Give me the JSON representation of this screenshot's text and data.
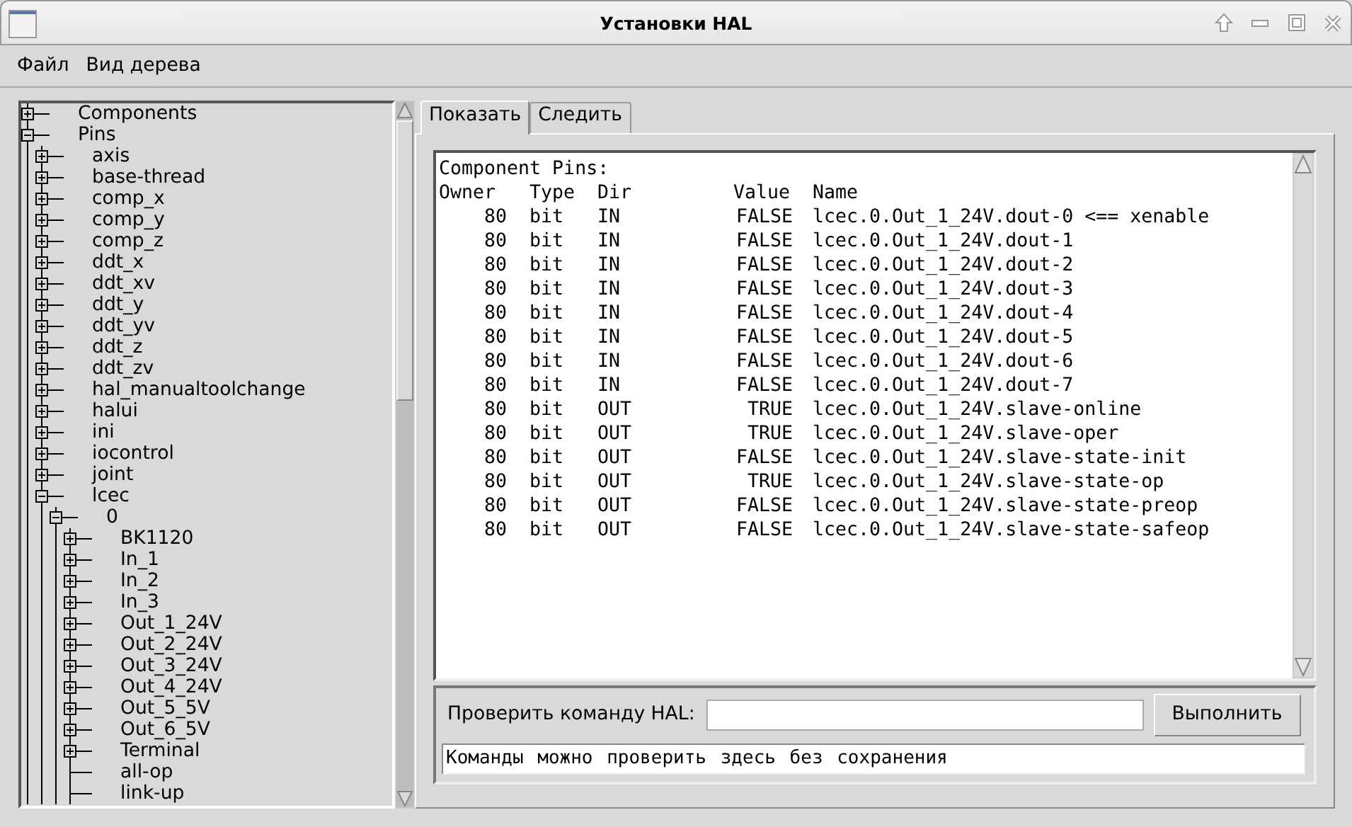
{
  "window": {
    "title": "Установки HAL"
  },
  "menu": [
    "Файл",
    "Вид дерева"
  ],
  "tree": [
    {
      "label": "Components",
      "kind": "branch",
      "expanded": false
    },
    {
      "label": "Pins",
      "kind": "branch",
      "expanded": true,
      "children": [
        {
          "label": "axis",
          "kind": "branch",
          "expanded": false
        },
        {
          "label": "base-thread",
          "kind": "branch",
          "expanded": false
        },
        {
          "label": "comp_x",
          "kind": "branch",
          "expanded": false
        },
        {
          "label": "comp_y",
          "kind": "branch",
          "expanded": false
        },
        {
          "label": "comp_z",
          "kind": "branch",
          "expanded": false
        },
        {
          "label": "ddt_x",
          "kind": "branch",
          "expanded": false
        },
        {
          "label": "ddt_xv",
          "kind": "branch",
          "expanded": false
        },
        {
          "label": "ddt_y",
          "kind": "branch",
          "expanded": false
        },
        {
          "label": "ddt_yv",
          "kind": "branch",
          "expanded": false
        },
        {
          "label": "ddt_z",
          "kind": "branch",
          "expanded": false
        },
        {
          "label": "ddt_zv",
          "kind": "branch",
          "expanded": false
        },
        {
          "label": "hal_manualtoolchange",
          "kind": "branch",
          "expanded": false
        },
        {
          "label": "halui",
          "kind": "branch",
          "expanded": false
        },
        {
          "label": "ini",
          "kind": "branch",
          "expanded": false
        },
        {
          "label": "iocontrol",
          "kind": "branch",
          "expanded": false
        },
        {
          "label": "joint",
          "kind": "branch",
          "expanded": false
        },
        {
          "label": "lcec",
          "kind": "branch",
          "expanded": true,
          "children": [
            {
              "label": "0",
              "kind": "branch",
              "expanded": true,
              "children": [
                {
                  "label": "BK1120",
                  "kind": "branch",
                  "expanded": false
                },
                {
                  "label": "In_1",
                  "kind": "branch",
                  "expanded": false
                },
                {
                  "label": "In_2",
                  "kind": "branch",
                  "expanded": false
                },
                {
                  "label": "In_3",
                  "kind": "branch",
                  "expanded": false
                },
                {
                  "label": "Out_1_24V",
                  "kind": "branch",
                  "expanded": false
                },
                {
                  "label": "Out_2_24V",
                  "kind": "branch",
                  "expanded": false
                },
                {
                  "label": "Out_3_24V",
                  "kind": "branch",
                  "expanded": false
                },
                {
                  "label": "Out_4_24V",
                  "kind": "branch",
                  "expanded": false
                },
                {
                  "label": "Out_5_5V",
                  "kind": "branch",
                  "expanded": false
                },
                {
                  "label": "Out_6_5V",
                  "kind": "branch",
                  "expanded": false
                },
                {
                  "label": "Terminal",
                  "kind": "branch",
                  "expanded": false
                },
                {
                  "label": "all-op",
                  "kind": "leaf"
                },
                {
                  "label": "link-up",
                  "kind": "leaf"
                }
              ]
            }
          ]
        }
      ]
    }
  ],
  "tabs": [
    {
      "label": "Показать",
      "selected": true
    },
    {
      "label": "Следить",
      "selected": false
    }
  ],
  "output": {
    "title": "Component Pins:",
    "columns": [
      "Owner",
      "Type",
      "Dir",
      "Value",
      "Name"
    ],
    "rows": [
      {
        "owner": "80",
        "type": "bit",
        "dir": "IN",
        "value": "FALSE",
        "name": "lcec.0.Out_1_24V.dout-0 <== xenable"
      },
      {
        "owner": "80",
        "type": "bit",
        "dir": "IN",
        "value": "FALSE",
        "name": "lcec.0.Out_1_24V.dout-1"
      },
      {
        "owner": "80",
        "type": "bit",
        "dir": "IN",
        "value": "FALSE",
        "name": "lcec.0.Out_1_24V.dout-2"
      },
      {
        "owner": "80",
        "type": "bit",
        "dir": "IN",
        "value": "FALSE",
        "name": "lcec.0.Out_1_24V.dout-3"
      },
      {
        "owner": "80",
        "type": "bit",
        "dir": "IN",
        "value": "FALSE",
        "name": "lcec.0.Out_1_24V.dout-4"
      },
      {
        "owner": "80",
        "type": "bit",
        "dir": "IN",
        "value": "FALSE",
        "name": "lcec.0.Out_1_24V.dout-5"
      },
      {
        "owner": "80",
        "type": "bit",
        "dir": "IN",
        "value": "FALSE",
        "name": "lcec.0.Out_1_24V.dout-6"
      },
      {
        "owner": "80",
        "type": "bit",
        "dir": "IN",
        "value": "FALSE",
        "name": "lcec.0.Out_1_24V.dout-7"
      },
      {
        "owner": "80",
        "type": "bit",
        "dir": "OUT",
        "value": "TRUE",
        "name": "lcec.0.Out_1_24V.slave-online"
      },
      {
        "owner": "80",
        "type": "bit",
        "dir": "OUT",
        "value": "TRUE",
        "name": "lcec.0.Out_1_24V.slave-oper"
      },
      {
        "owner": "80",
        "type": "bit",
        "dir": "OUT",
        "value": "FALSE",
        "name": "lcec.0.Out_1_24V.slave-state-init"
      },
      {
        "owner": "80",
        "type": "bit",
        "dir": "OUT",
        "value": "TRUE",
        "name": "lcec.0.Out_1_24V.slave-state-op"
      },
      {
        "owner": "80",
        "type": "bit",
        "dir": "OUT",
        "value": "FALSE",
        "name": "lcec.0.Out_1_24V.slave-state-preop"
      },
      {
        "owner": "80",
        "type": "bit",
        "dir": "OUT",
        "value": "FALSE",
        "name": "lcec.0.Out_1_24V.slave-state-safeop"
      }
    ]
  },
  "command": {
    "label": "Проверить команду HAL:",
    "button": "Выполнить",
    "message": "Команды можно проверить здесь без сохранения"
  }
}
